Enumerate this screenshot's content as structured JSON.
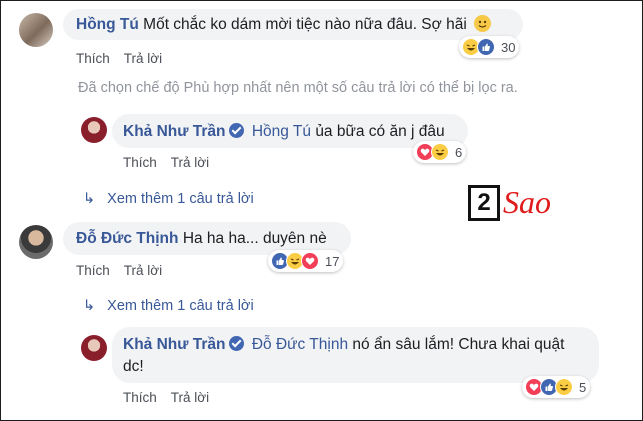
{
  "comments": [
    {
      "name": "Hồng Tú",
      "text": "Mốt chắc ko dám mời tiệc nào nữa đâu. Sợ hãi",
      "emoji": "smile-emoji",
      "reactions": [
        "haha",
        "like"
      ],
      "count": "30",
      "actions": [
        "Thích",
        "Trả lời"
      ]
    },
    {
      "notice": "Đã chọn chế độ Phù hợp nhất nên một số câu trả lời có thể bị lọc ra."
    },
    {
      "name": "Khả Như Trần",
      "mention": "Hồng Tú",
      "text": "ủa bữa có ăn j đâu",
      "reactions": [
        "love",
        "haha"
      ],
      "count": "6",
      "actions": [
        "Thích",
        "Trả lời"
      ]
    },
    {
      "more": "Xem thêm 1 câu trả lời"
    },
    {
      "name": "Đỗ Đức Thịnh",
      "text": "Ha ha ha... duyên nè",
      "reactions": [
        "like",
        "haha",
        "love"
      ],
      "count": "17",
      "actions": [
        "Thích",
        "Trả lời"
      ]
    },
    {
      "more": "Xem thêm 1 câu trả lời"
    },
    {
      "name": "Khả Như Trần",
      "mention": "Đỗ Đức Thịnh",
      "text_line1": "nó ẩn sâu lắm! Chưa khai quật",
      "text_line2": "dc!",
      "reactions": [
        "love",
        "like",
        "haha"
      ],
      "count": "5",
      "actions": [
        "Thích",
        "Trả lời"
      ]
    }
  ],
  "watermark": {
    "number": "2",
    "word": "Sao"
  },
  "colors": {
    "name": "#385898",
    "bubble": "#f2f3f5",
    "like": "#4267b2",
    "love": "#f33e58",
    "haha": "#fbcd44"
  }
}
